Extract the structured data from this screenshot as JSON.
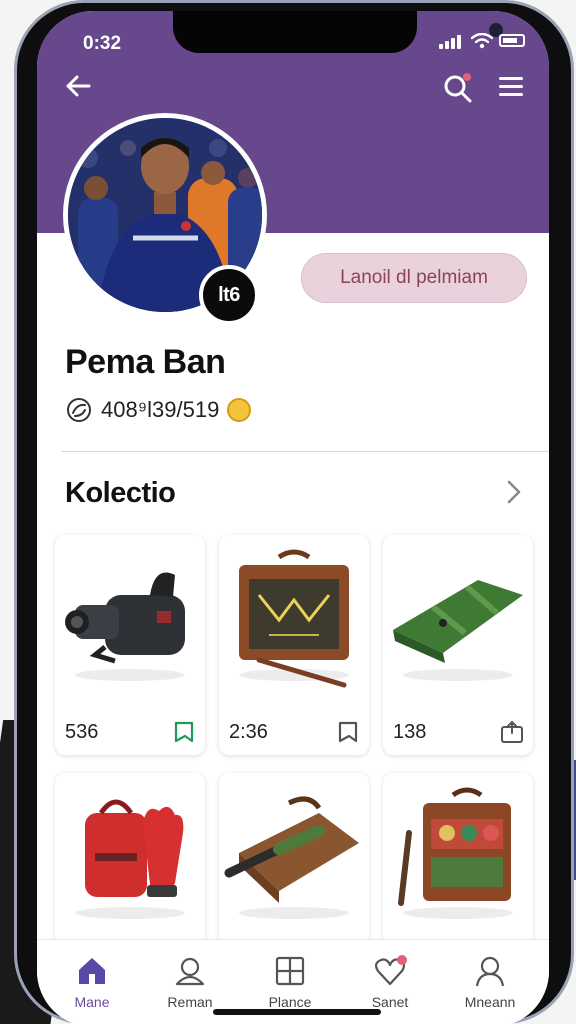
{
  "status_bar": {
    "time": "0:32"
  },
  "profile": {
    "name": "Pema Ban",
    "badge": "lt6",
    "follow_label": "Lanoil dl pelmiam",
    "stats": "408⁹l39/519"
  },
  "collection": {
    "title": "Kolectio",
    "items": [
      {
        "count": "536",
        "icon": "bookmark-icon",
        "icon_color": "#1f9a5a"
      },
      {
        "count": "2:36",
        "icon": "bookmark-icon",
        "icon_color": "#555555"
      },
      {
        "count": "138",
        "icon": "share-icon",
        "icon_color": "#555555"
      },
      {
        "count": "",
        "icon": ""
      },
      {
        "count": "",
        "icon": ""
      },
      {
        "count": "",
        "icon": ""
      }
    ]
  },
  "bottom_nav": [
    {
      "label": "Mane",
      "icon": "home-icon",
      "active": true
    },
    {
      "label": "Reman",
      "icon": "user-icon"
    },
    {
      "label": "Plance",
      "icon": "grid-icon"
    },
    {
      "label": "Sanet",
      "icon": "heart-icon"
    },
    {
      "label": "Mneann",
      "icon": "profile-icon"
    }
  ],
  "colors": {
    "header": "#67488c",
    "accent": "#6a4b99",
    "follow_bg": "#ead2dc",
    "follow_text": "#8b4357",
    "notification_dot": "#e2607a"
  }
}
